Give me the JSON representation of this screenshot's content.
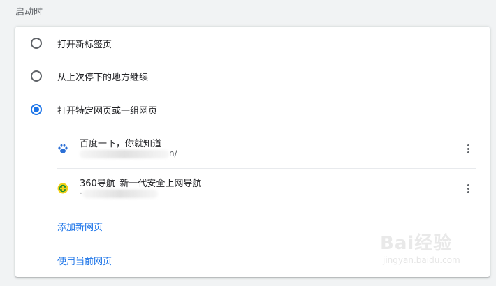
{
  "section": {
    "title": "启动时"
  },
  "options": [
    {
      "label": "打开新标签页",
      "checked": false
    },
    {
      "label": "从上次停下的地方继续",
      "checked": false
    },
    {
      "label": "打开特定网页或一组网页",
      "checked": true
    }
  ],
  "pages": [
    {
      "title": "百度一下，你就知道",
      "url_suffix": "n/",
      "icon": "baidu-paw-icon"
    },
    {
      "title": "360导航_新一代安全上网导航",
      "url_suffix": "·",
      "icon": "360-logo-icon"
    }
  ],
  "actions": {
    "add_page": "添加新网页",
    "use_current": "使用当前网页"
  },
  "watermark": {
    "text": "Bai经验",
    "sub": "jingyan.baidu.com"
  },
  "colors": {
    "accent": "#1a73e8",
    "text": "#202124",
    "secondary": "#5f6368"
  }
}
